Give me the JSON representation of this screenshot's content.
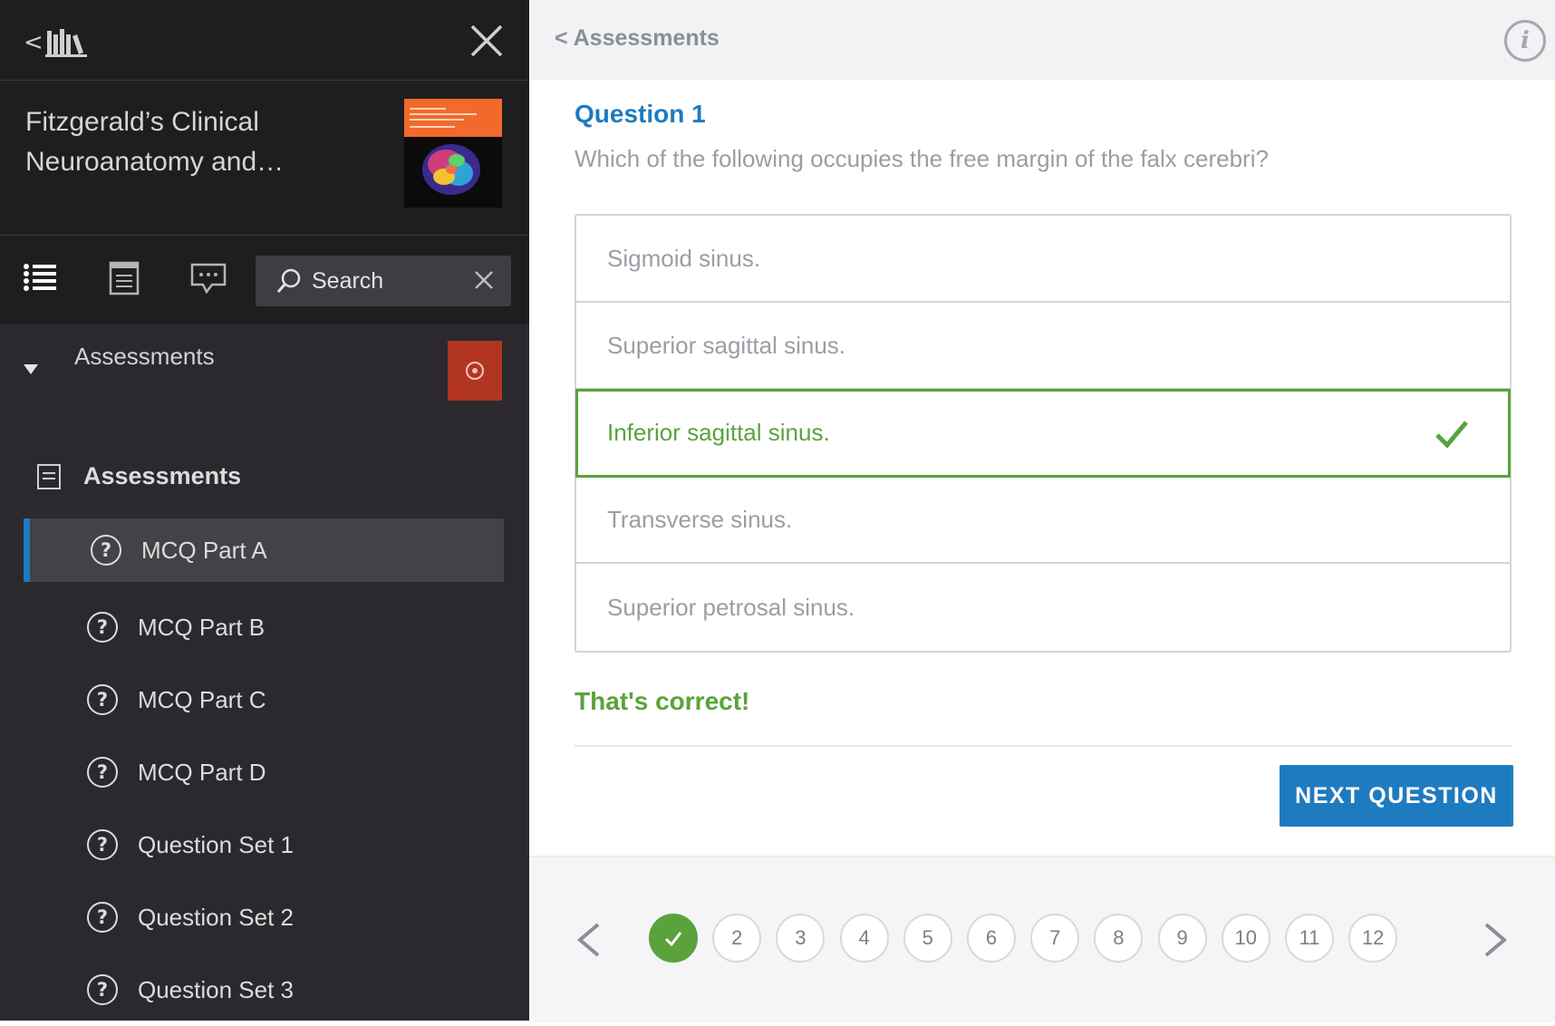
{
  "sidebar": {
    "book_title": "Fitzgerald’s Clinical Neuroanatomy and…",
    "search_label": "Search",
    "section_label": "Assessments",
    "assessments_heading": "Assessments",
    "items": [
      {
        "label": "MCQ Part A",
        "active": true
      },
      {
        "label": "MCQ Part B",
        "active": false
      },
      {
        "label": "MCQ Part C",
        "active": false
      },
      {
        "label": "MCQ Part D",
        "active": false
      },
      {
        "label": "Question Set 1",
        "active": false
      },
      {
        "label": "Question Set 2",
        "active": false
      },
      {
        "label": "Question Set 3",
        "active": false
      }
    ],
    "icons": [
      "library-back-icon",
      "close-icon",
      "toc-list-icon",
      "notes-icon",
      "comments-icon",
      "search-icon",
      "clear-icon",
      "help-icon",
      "document-icon",
      "question-icon"
    ]
  },
  "main": {
    "back_link": "< Assessments",
    "info_icon_glyph": "i",
    "question_title": "Question 1",
    "question_text": "Which of the following occupies the free margin of the falx cerebri?",
    "options": [
      {
        "label": "Sigmoid sinus.",
        "correct": false
      },
      {
        "label": "Superior sagittal sinus.",
        "correct": false
      },
      {
        "label": "Inferior sagittal sinus.",
        "correct": true
      },
      {
        "label": "Transverse sinus.",
        "correct": false
      },
      {
        "label": "Superior petrosal sinus.",
        "correct": false
      }
    ],
    "feedback": "That's correct!",
    "next_button": "NEXT QUESTION",
    "pager": [
      "1",
      "2",
      "3",
      "4",
      "5",
      "6",
      "7",
      "8",
      "9",
      "10",
      "11",
      "12"
    ],
    "pager_done": [
      1
    ]
  },
  "colors": {
    "accent": "#1f7bbf",
    "correct": "#5aa33c",
    "sidebar_bg": "#2b292e",
    "help_button": "#b23522"
  }
}
